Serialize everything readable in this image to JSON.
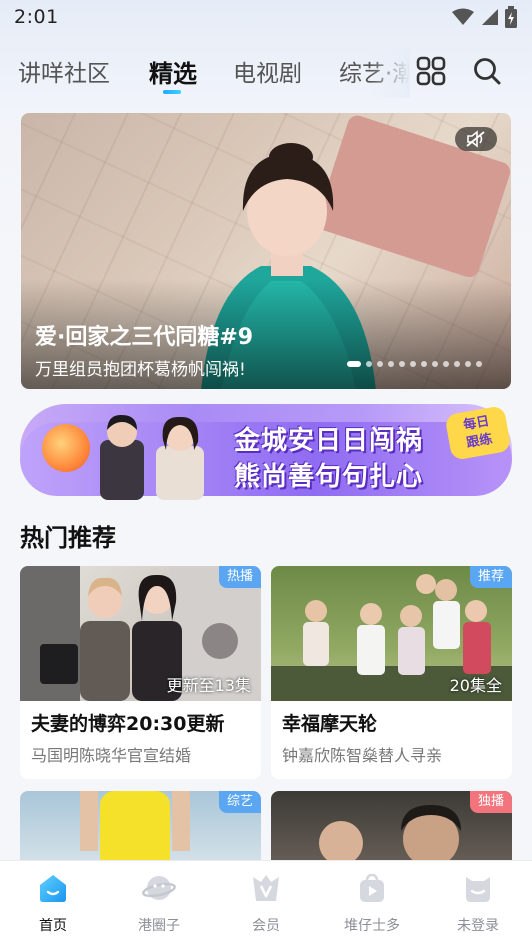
{
  "status_bar": {
    "time": "2:01"
  },
  "top_tabs": [
    "讲咩社区",
    "精选",
    "电视剧",
    "综艺·潮"
  ],
  "hero": {
    "title": "爱·回家之三代同糖#9",
    "subtitle": "万里组员抱团杯葛杨帆闯祸!",
    "total_slides": 12,
    "active_slide": 1
  },
  "banner": {
    "line1": "金城安日日闯祸",
    "line2": "熊尚善句句扎心",
    "badge_line1": "每日",
    "badge_line2": "跟练"
  },
  "section": {
    "title": "热门推荐"
  },
  "cards": [
    {
      "badge": "热播",
      "badge_color": "#5aa6f2",
      "episode": "更新至13集",
      "title": "夫妻的博弈20:30更新",
      "subtitle": "马国明陈晓华官宣结婚"
    },
    {
      "badge": "推荐",
      "badge_color": "#5aa6f2",
      "episode": "20集全",
      "title": "幸福摩天轮",
      "subtitle": "钟嘉欣陈智燊替人寻亲"
    },
    {
      "badge": "综艺",
      "badge_color": "#5aa6f2",
      "episode": "",
      "title": "",
      "subtitle": ""
    },
    {
      "badge": "独播",
      "badge_color": "#f2747d",
      "episode": "",
      "title": "",
      "subtitle": ""
    }
  ],
  "bottom_nav": [
    "首页",
    "港圈子",
    "会员",
    "堆仔士多",
    "未登录"
  ],
  "colors": {
    "accent": "#1fa8ff",
    "nav_active": "#35b3f5"
  }
}
